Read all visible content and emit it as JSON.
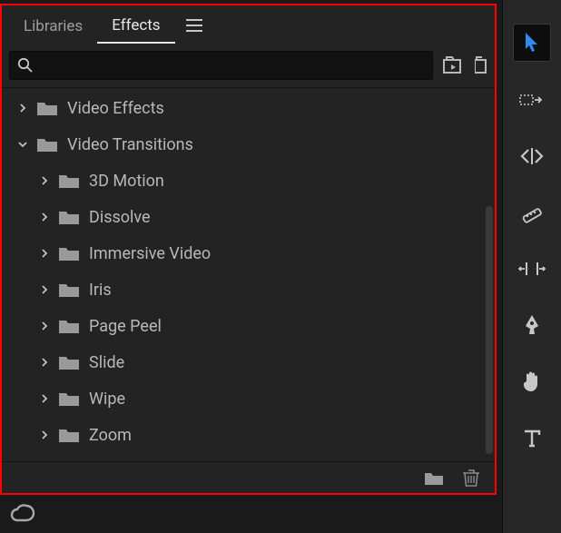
{
  "tabs": {
    "libraries": "Libraries",
    "effects": "Effects"
  },
  "search": {
    "placeholder": ""
  },
  "tree": [
    {
      "label": "Video Effects",
      "level": 0,
      "expanded": false
    },
    {
      "label": "Video Transitions",
      "level": 0,
      "expanded": true
    },
    {
      "label": "3D Motion",
      "level": 1,
      "expanded": false
    },
    {
      "label": "Dissolve",
      "level": 1,
      "expanded": false
    },
    {
      "label": "Immersive Video",
      "level": 1,
      "expanded": false
    },
    {
      "label": "Iris",
      "level": 1,
      "expanded": false
    },
    {
      "label": "Page Peel",
      "level": 1,
      "expanded": false
    },
    {
      "label": "Slide",
      "level": 1,
      "expanded": false
    },
    {
      "label": "Wipe",
      "level": 1,
      "expanded": false
    },
    {
      "label": "Zoom",
      "level": 1,
      "expanded": false
    }
  ],
  "icons": {
    "search": "search-icon",
    "panel_menu": "panel-menu-icon",
    "preset_bin": "preset-bin-icon",
    "extra": "extra-icon",
    "new_bin": "new-bin-icon",
    "trash": "trash-icon",
    "cc": "creative-cloud-icon"
  },
  "tools": [
    {
      "name": "selection-tool",
      "active": true
    },
    {
      "name": "track-select-tool",
      "active": false
    },
    {
      "name": "ripple-edit-tool",
      "active": false
    },
    {
      "name": "razor-tool",
      "active": false
    },
    {
      "name": "slip-tool",
      "active": false
    },
    {
      "name": "pen-tool",
      "active": false
    },
    {
      "name": "hand-tool",
      "active": false
    },
    {
      "name": "type-tool",
      "active": false
    }
  ]
}
